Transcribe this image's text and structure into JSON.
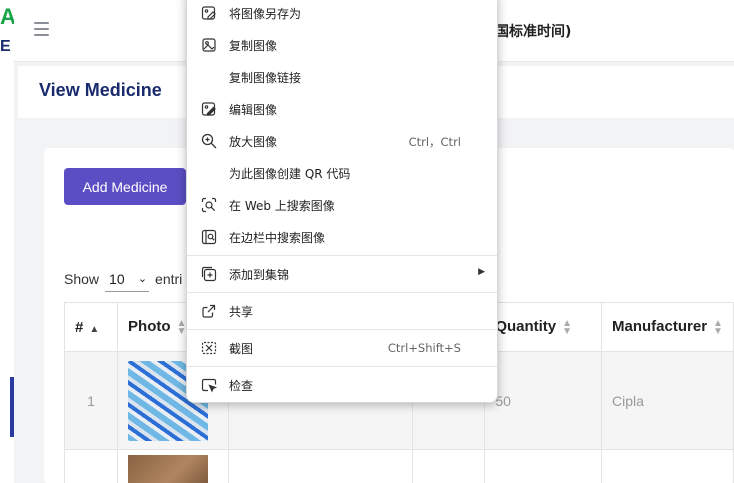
{
  "logo": {
    "letter_top": "A",
    "letter_bottom": "E",
    "color_green": "#18a54a",
    "color_navy": "#1a2b6d"
  },
  "header": {
    "menu_icon": "hamburger-icon",
    "time_text": "国标准时间)"
  },
  "page": {
    "title": "View Medicine"
  },
  "toolbar": {
    "add_label": "Add Medicine",
    "accent": "#5b4ec4"
  },
  "length": {
    "show_label": "Show",
    "value": "10",
    "suffix": "entri"
  },
  "table": {
    "headers": [
      "#",
      "Photo",
      "Quantity",
      "Manufacturer"
    ],
    "rows": [
      {
        "index": "1",
        "quantity": "50",
        "manufacturer": "Cipla"
      }
    ]
  },
  "context_menu": {
    "items": [
      {
        "label": "将图像另存为",
        "icon": "save-image-icon"
      },
      {
        "label": "复制图像",
        "icon": "copy-image-icon"
      },
      {
        "label": "复制图像链接",
        "icon": ""
      },
      {
        "label": "编辑图像",
        "icon": "edit-image-icon"
      },
      {
        "label": "放大图像",
        "icon": "zoom-in-icon",
        "shortcut": "Ctrl，Ctrl"
      },
      {
        "label": "为此图像创建 QR 代码",
        "icon": ""
      },
      {
        "label": "在 Web 上搜索图像",
        "icon": "visual-search-icon"
      },
      {
        "label": "在边栏中搜索图像",
        "icon": "sidebar-search-icon"
      },
      {
        "label": "添加到集锦",
        "icon": "collections-icon"
      },
      {
        "label": "共享",
        "icon": "share-icon"
      },
      {
        "label": "截图",
        "icon": "screenshot-icon",
        "shortcut": "Ctrl+Shift+S"
      },
      {
        "label": "检查",
        "icon": "inspect-icon"
      }
    ]
  }
}
